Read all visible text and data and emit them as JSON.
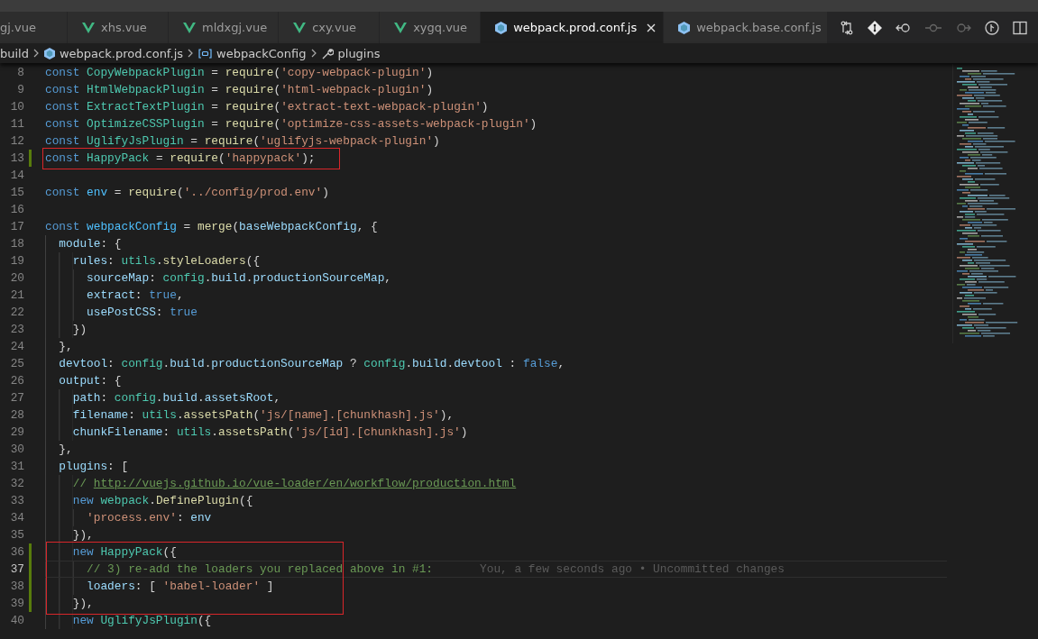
{
  "tabs": [
    {
      "label": "gj.vue",
      "kind": "none",
      "selected": false
    },
    {
      "label": "xhs.vue",
      "kind": "vue",
      "selected": false
    },
    {
      "label": "mldxgj.vue",
      "kind": "vue",
      "selected": false
    },
    {
      "label": "cxy.vue",
      "kind": "vue",
      "selected": false
    },
    {
      "label": "xygq.vue",
      "kind": "vue",
      "selected": false
    },
    {
      "label": "webpack.prod.conf.js",
      "kind": "js",
      "selected": true
    },
    {
      "label": "webpack.base.conf.js",
      "kind": "js",
      "selected": false
    }
  ],
  "breadcrumb": [
    {
      "text": "build",
      "kind": "folder"
    },
    {
      "text": "webpack.prod.conf.js",
      "kind": "file"
    },
    {
      "text": "webpackConfig",
      "kind": "variable"
    },
    {
      "text": "plugins",
      "kind": "property"
    }
  ],
  "lines": [
    {
      "number": "8",
      "modified": false,
      "current": false,
      "tokens": [
        {
          "kind": "kw",
          "text": "const "
        },
        {
          "kind": "cls",
          "text": "CopyWebpackPlugin"
        },
        {
          "kind": "op",
          "text": " = "
        },
        {
          "kind": "fn",
          "text": "require"
        },
        {
          "kind": "op",
          "text": "("
        },
        {
          "kind": "str",
          "text": "'copy-webpack-plugin'"
        },
        {
          "kind": "op",
          "text": ")"
        }
      ]
    },
    {
      "number": "9",
      "modified": false,
      "current": false,
      "tokens": [
        {
          "kind": "kw",
          "text": "const "
        },
        {
          "kind": "cls",
          "text": "HtmlWebpackPlugin"
        },
        {
          "kind": "op",
          "text": " = "
        },
        {
          "kind": "fn",
          "text": "require"
        },
        {
          "kind": "op",
          "text": "("
        },
        {
          "kind": "str",
          "text": "'html-webpack-plugin'"
        },
        {
          "kind": "op",
          "text": ")"
        }
      ]
    },
    {
      "number": "10",
      "modified": false,
      "current": false,
      "tokens": [
        {
          "kind": "kw",
          "text": "const "
        },
        {
          "kind": "cls",
          "text": "ExtractTextPlugin"
        },
        {
          "kind": "op",
          "text": " = "
        },
        {
          "kind": "fn",
          "text": "require"
        },
        {
          "kind": "op",
          "text": "("
        },
        {
          "kind": "str",
          "text": "'extract-text-webpack-plugin'"
        },
        {
          "kind": "op",
          "text": ")"
        }
      ]
    },
    {
      "number": "11",
      "modified": false,
      "current": false,
      "tokens": [
        {
          "kind": "kw",
          "text": "const "
        },
        {
          "kind": "cls",
          "text": "OptimizeCSSPlugin"
        },
        {
          "kind": "op",
          "text": " = "
        },
        {
          "kind": "fn",
          "text": "require"
        },
        {
          "kind": "op",
          "text": "("
        },
        {
          "kind": "str",
          "text": "'optimize-css-assets-webpack-plugin'"
        },
        {
          "kind": "op",
          "text": ")"
        }
      ]
    },
    {
      "number": "12",
      "modified": false,
      "current": false,
      "tokens": [
        {
          "kind": "kw",
          "text": "const "
        },
        {
          "kind": "cls",
          "text": "UglifyJsPlugin"
        },
        {
          "kind": "op",
          "text": " = "
        },
        {
          "kind": "fn",
          "text": "require"
        },
        {
          "kind": "op",
          "text": "("
        },
        {
          "kind": "str",
          "text": "'uglifyjs-webpack-plugin'"
        },
        {
          "kind": "op",
          "text": ")"
        }
      ]
    },
    {
      "number": "13",
      "modified": true,
      "current": false,
      "boxed": true,
      "tokens": [
        {
          "kind": "kw",
          "text": "const "
        },
        {
          "kind": "cls",
          "text": "HappyPack"
        },
        {
          "kind": "op",
          "text": " = "
        },
        {
          "kind": "fn",
          "text": "require"
        },
        {
          "kind": "op",
          "text": "("
        },
        {
          "kind": "str",
          "text": "'happypack'"
        },
        {
          "kind": "op",
          "text": ");"
        }
      ]
    },
    {
      "number": "14",
      "modified": false,
      "current": false
    },
    {
      "number": "15",
      "modified": false,
      "current": false,
      "tokens": [
        {
          "kind": "kw",
          "text": "const "
        },
        {
          "kind": "var",
          "text": "env"
        },
        {
          "kind": "op",
          "text": " = "
        },
        {
          "kind": "fn",
          "text": "require"
        },
        {
          "kind": "op",
          "text": "("
        },
        {
          "kind": "str",
          "text": "'../config/prod.env'"
        },
        {
          "kind": "op",
          "text": ")"
        }
      ]
    },
    {
      "number": "16",
      "modified": false,
      "current": false
    },
    {
      "number": "17",
      "modified": false,
      "current": false,
      "tokens": [
        {
          "kind": "kw",
          "text": "const "
        },
        {
          "kind": "var",
          "text": "webpackConfig"
        },
        {
          "kind": "op",
          "text": " = "
        },
        {
          "kind": "fn",
          "text": "merge"
        },
        {
          "kind": "op",
          "text": "("
        },
        {
          "kind": "prop",
          "text": "baseWebpackConfig"
        },
        {
          "kind": "op",
          "text": ", {"
        }
      ]
    },
    {
      "number": "18",
      "modified": false,
      "current": false,
      "tokens": [
        {
          "kind": "prop",
          "text": "  module"
        },
        {
          "kind": "op",
          "text": ": {"
        }
      ]
    },
    {
      "number": "19",
      "modified": false,
      "current": false,
      "tokens": [
        {
          "kind": "prop",
          "text": "    rules"
        },
        {
          "kind": "op",
          "text": ": "
        },
        {
          "kind": "cls",
          "text": "utils"
        },
        {
          "kind": "op",
          "text": "."
        },
        {
          "kind": "fn",
          "text": "styleLoaders"
        },
        {
          "kind": "op",
          "text": "({"
        }
      ]
    },
    {
      "number": "20",
      "modified": false,
      "current": false,
      "tokens": [
        {
          "kind": "prop",
          "text": "      sourceMap"
        },
        {
          "kind": "op",
          "text": ": "
        },
        {
          "kind": "cls",
          "text": "config"
        },
        {
          "kind": "op",
          "text": "."
        },
        {
          "kind": "prop",
          "text": "build"
        },
        {
          "kind": "op",
          "text": "."
        },
        {
          "kind": "prop",
          "text": "productionSourceMap"
        },
        {
          "kind": "op",
          "text": ","
        }
      ]
    },
    {
      "number": "21",
      "modified": false,
      "current": false,
      "tokens": [
        {
          "kind": "prop",
          "text": "      extract"
        },
        {
          "kind": "op",
          "text": ": "
        },
        {
          "kind": "kw",
          "text": "true"
        },
        {
          "kind": "op",
          "text": ","
        }
      ]
    },
    {
      "number": "22",
      "modified": false,
      "current": false,
      "tokens": [
        {
          "kind": "prop",
          "text": "      usePostCSS"
        },
        {
          "kind": "op",
          "text": ": "
        },
        {
          "kind": "kw",
          "text": "true"
        }
      ]
    },
    {
      "number": "23",
      "modified": false,
      "current": false,
      "tokens": [
        {
          "kind": "op",
          "text": "    })"
        }
      ]
    },
    {
      "number": "24",
      "modified": false,
      "current": false,
      "tokens": [
        {
          "kind": "op",
          "text": "  },"
        }
      ]
    },
    {
      "number": "25",
      "modified": false,
      "current": false,
      "tokens": [
        {
          "kind": "prop",
          "text": "  devtool"
        },
        {
          "kind": "op",
          "text": ": "
        },
        {
          "kind": "cls",
          "text": "config"
        },
        {
          "kind": "op",
          "text": "."
        },
        {
          "kind": "prop",
          "text": "build"
        },
        {
          "kind": "op",
          "text": "."
        },
        {
          "kind": "prop",
          "text": "productionSourceMap"
        },
        {
          "kind": "op",
          "text": " ? "
        },
        {
          "kind": "cls",
          "text": "config"
        },
        {
          "kind": "op",
          "text": "."
        },
        {
          "kind": "prop",
          "text": "build"
        },
        {
          "kind": "op",
          "text": "."
        },
        {
          "kind": "prop",
          "text": "devtool"
        },
        {
          "kind": "op",
          "text": " : "
        },
        {
          "kind": "kw",
          "text": "false"
        },
        {
          "kind": "op",
          "text": ","
        }
      ]
    },
    {
      "number": "26",
      "modified": false,
      "current": false,
      "tokens": [
        {
          "kind": "prop",
          "text": "  output"
        },
        {
          "kind": "op",
          "text": ": {"
        }
      ]
    },
    {
      "number": "27",
      "modified": false,
      "current": false,
      "tokens": [
        {
          "kind": "prop",
          "text": "    path"
        },
        {
          "kind": "op",
          "text": ": "
        },
        {
          "kind": "cls",
          "text": "config"
        },
        {
          "kind": "op",
          "text": "."
        },
        {
          "kind": "prop",
          "text": "build"
        },
        {
          "kind": "op",
          "text": "."
        },
        {
          "kind": "prop",
          "text": "assetsRoot"
        },
        {
          "kind": "op",
          "text": ","
        }
      ]
    },
    {
      "number": "28",
      "modified": false,
      "current": false,
      "tokens": [
        {
          "kind": "prop",
          "text": "    filename"
        },
        {
          "kind": "op",
          "text": ": "
        },
        {
          "kind": "cls",
          "text": "utils"
        },
        {
          "kind": "op",
          "text": "."
        },
        {
          "kind": "fn",
          "text": "assetsPath"
        },
        {
          "kind": "op",
          "text": "("
        },
        {
          "kind": "str",
          "text": "'js/[name].[chunkhash].js'"
        },
        {
          "kind": "op",
          "text": "),"
        }
      ]
    },
    {
      "number": "29",
      "modified": false,
      "current": false,
      "tokens": [
        {
          "kind": "prop",
          "text": "    chunkFilename"
        },
        {
          "kind": "op",
          "text": ": "
        },
        {
          "kind": "cls",
          "text": "utils"
        },
        {
          "kind": "op",
          "text": "."
        },
        {
          "kind": "fn",
          "text": "assetsPath"
        },
        {
          "kind": "op",
          "text": "("
        },
        {
          "kind": "str",
          "text": "'js/[id].[chunkhash].js'"
        },
        {
          "kind": "op",
          "text": ")"
        }
      ]
    },
    {
      "number": "30",
      "modified": false,
      "current": false,
      "tokens": [
        {
          "kind": "op",
          "text": "  },"
        }
      ]
    },
    {
      "number": "31",
      "modified": false,
      "current": false,
      "tokens": [
        {
          "kind": "prop",
          "text": "  plugins"
        },
        {
          "kind": "op",
          "text": ": ["
        }
      ]
    },
    {
      "number": "32",
      "modified": false,
      "current": false,
      "tokens": [
        {
          "kind": "com",
          "text": "    // "
        },
        {
          "kind": "link",
          "text": "http://vuejs.github.io/vue-loader/en/workflow/production.html"
        }
      ]
    },
    {
      "number": "33",
      "modified": false,
      "current": false,
      "tokens": [
        {
          "kind": "kw",
          "text": "    new "
        },
        {
          "kind": "cls",
          "text": "webpack"
        },
        {
          "kind": "op",
          "text": "."
        },
        {
          "kind": "fn",
          "text": "DefinePlugin"
        },
        {
          "kind": "op",
          "text": "({"
        }
      ]
    },
    {
      "number": "34",
      "modified": false,
      "current": false,
      "tokens": [
        {
          "kind": "str",
          "text": "      'process.env'"
        },
        {
          "kind": "op",
          "text": ": "
        },
        {
          "kind": "prop",
          "text": "env"
        }
      ]
    },
    {
      "number": "35",
      "modified": false,
      "current": false,
      "tokens": [
        {
          "kind": "op",
          "text": "    }),"
        }
      ]
    },
    {
      "number": "36",
      "modified": true,
      "current": false,
      "boxed": true,
      "tokens": [
        {
          "kind": "kw",
          "text": "    new "
        },
        {
          "kind": "cls",
          "text": "HappyPack"
        },
        {
          "kind": "op",
          "text": "({"
        }
      ]
    },
    {
      "number": "37",
      "modified": true,
      "current": true,
      "boxed": true,
      "tokens": [
        {
          "kind": "com",
          "text": "      // 3) re-add the loaders you replaced above in #1:"
        }
      ],
      "blame": "You, a few seconds ago • Uncommitted changes"
    },
    {
      "number": "38",
      "modified": true,
      "current": false,
      "boxed": true,
      "tokens": [
        {
          "kind": "prop",
          "text": "      loaders"
        },
        {
          "kind": "op",
          "text": ": [ "
        },
        {
          "kind": "str",
          "text": "'babel-loader'"
        },
        {
          "kind": "op",
          "text": " ]"
        }
      ]
    },
    {
      "number": "39",
      "modified": true,
      "current": false,
      "boxed": true,
      "tokens": [
        {
          "kind": "op",
          "text": "    }),"
        }
      ]
    },
    {
      "number": "40",
      "modified": false,
      "current": false,
      "tokens": [
        {
          "kind": "kw",
          "text": "    new "
        },
        {
          "kind": "cls",
          "text": "UglifyJsPlugin"
        },
        {
          "kind": "op",
          "text": "({"
        }
      ]
    }
  ]
}
